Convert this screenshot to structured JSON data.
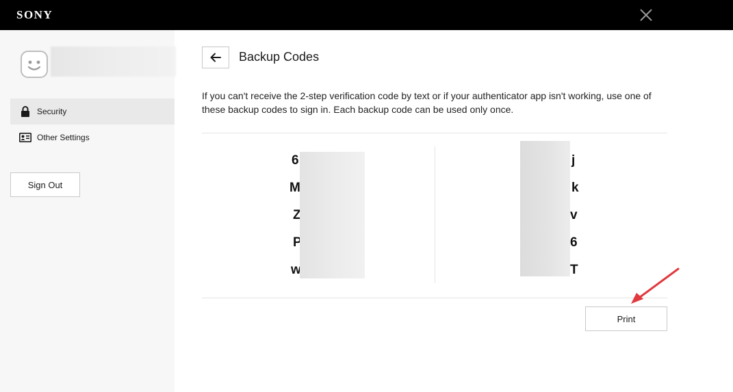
{
  "header": {
    "brand": "SONY",
    "close_icon": "close-icon"
  },
  "sidebar": {
    "avatar_icon": "smiley-avatar-icon",
    "items": [
      {
        "label": "Security",
        "icon": "lock-icon",
        "active": true
      },
      {
        "label": "Other Settings",
        "icon": "id-card-icon",
        "active": false
      }
    ],
    "sign_out_label": "Sign Out"
  },
  "main": {
    "back_icon": "arrow-left-icon",
    "title": "Backup Codes",
    "description": "If you can't receive the 2-step verification code by text or if your authenticator app isn't working, use one of these backup codes to sign in. Each backup code can be used only once.",
    "codes_left": [
      "6",
      "M",
      "Z",
      "P",
      "w"
    ],
    "codes_right": [
      "j",
      "k",
      "v",
      "6",
      "T"
    ],
    "print_label": "Print"
  },
  "annotation": {
    "arrow_color": "#e0393e"
  }
}
